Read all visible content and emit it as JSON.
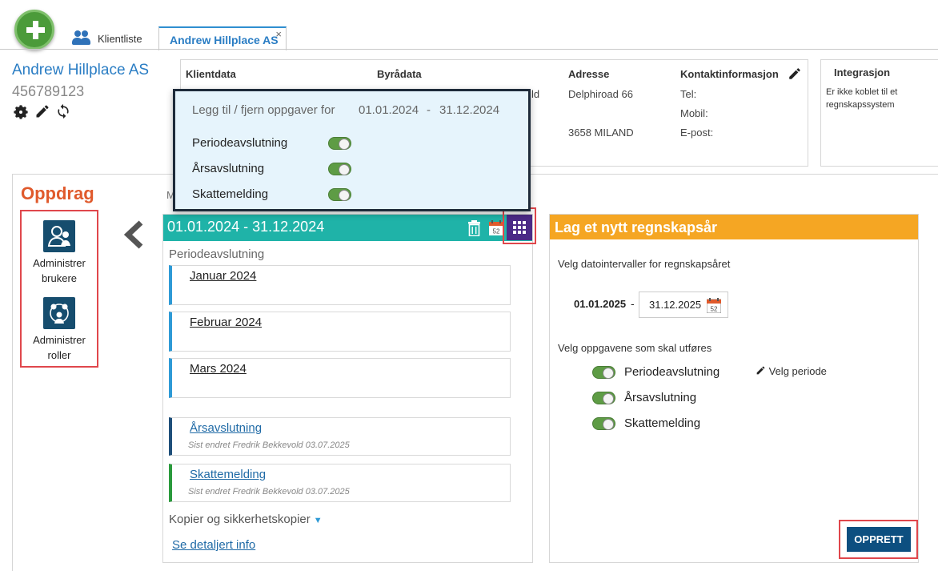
{
  "tabs": [
    {
      "label": "Klientliste"
    },
    {
      "label": "Andrew Hillplace AS",
      "close": "×"
    }
  ],
  "client": {
    "name": "Andrew Hillplace AS",
    "number": "456789123"
  },
  "info": {
    "klientdata": "Klientdata",
    "byradata": "Byrådata",
    "byradata_trunc": "ld",
    "adresse": "Adresse",
    "adresse_line1": "Delphiroad 66",
    "adresse_line2": "3658 MILAND",
    "kontakt": "Kontaktinformasjon",
    "tel": "Tel:",
    "mobil": "Mobil:",
    "epost": "E-post:"
  },
  "integrasjon": {
    "title": "Integrasjon",
    "text": "Er ikke koblet til et regnskapssystem"
  },
  "oppdrag": {
    "title": "Oppdrag",
    "truncated": "M",
    "admin_users": [
      "Administrer",
      "brukere"
    ],
    "admin_roles": [
      "Administrer",
      "roller"
    ]
  },
  "period": {
    "header_from": "01.01.2024",
    "header_sep": "-",
    "header_to": "31.12.2024",
    "sub_label": "Periodeavslutning",
    "months": [
      "Januar 2024",
      "Februar 2024",
      "Mars 2024"
    ],
    "arsavslutning": {
      "label": "Årsavslutning",
      "meta": "Sist endret Fredrik Bekkevold 03.07.2025"
    },
    "skattemelding": {
      "label": "Skattemelding",
      "meta": "Sist endret Fredrik Bekkevold 03.07.2025"
    },
    "kopier": "Kopier og sikkerhetskopier",
    "detalj": "Se detaljert info"
  },
  "popup": {
    "title": "Legg til / fjern oppgaver for",
    "from": "01.01.2024",
    "sep": "-",
    "to": "31.12.2024",
    "items": [
      "Periodeavslutning",
      "Årsavslutning",
      "Skattemelding"
    ]
  },
  "new_year": {
    "title": "Lag et nytt regnskapsår",
    "date_prompt": "Velg datointervaller for regnskapsåret",
    "from": "01.01.2025",
    "sep": "-",
    "to": "31.12.2025",
    "task_prompt": "Velg oppgavene som skal utføres",
    "tasks": [
      "Periodeavslutning",
      "Årsavslutning",
      "Skattemelding"
    ],
    "velg_periode": "Velg periode",
    "submit": "OPPRETT"
  },
  "calendar_badge": "52",
  "icons": {
    "add": "plus-icon",
    "users": "users-icon",
    "settings": "gear-icon",
    "edit": "pencil-icon",
    "sync": "sync-icon",
    "back": "chevron-left-icon",
    "trash": "trash-icon",
    "calendar": "calendar-icon",
    "grid": "grid-icon",
    "dropdown": "caret-down-icon"
  },
  "colors": {
    "accent_blue": "#2a7dc4",
    "teal_header": "#1fb3a8",
    "orange_header": "#f5a623",
    "oppdrag_red": "#e05a2c",
    "highlight_red": "#e0474c",
    "grid_purple": "#4b2a86",
    "button_navy": "#0d4f80",
    "toggle_green": "#5e9c45"
  }
}
